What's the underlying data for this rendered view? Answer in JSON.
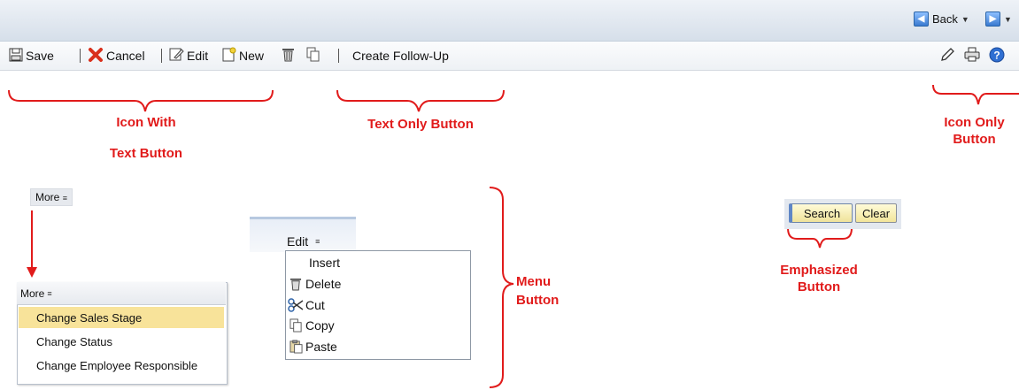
{
  "header": {
    "back_label": "Back",
    "forward_label": ""
  },
  "toolbar": {
    "save_label": "Save",
    "cancel_label": "Cancel",
    "edit_label": "Edit",
    "new_label": "New",
    "create_followup_label": "Create Follow-Up",
    "icons": [
      "save-icon",
      "cancel-icon",
      "edit-icon",
      "new-icon",
      "delete-icon",
      "copy-icon",
      "pencil-icon",
      "print-icon",
      "help-icon"
    ]
  },
  "annotations": {
    "icon_with_text_line1": "Icon With",
    "icon_with_text_line2": "Text Button",
    "text_only": "Text Only Button",
    "icon_only_line1": "Icon Only",
    "icon_only_line2": "Button",
    "menu_line1": "Menu",
    "menu_line2": "Button",
    "emphasized_line1": "Emphasized",
    "emphasized_line2": "Button"
  },
  "more_menu": {
    "label": "More",
    "items": [
      {
        "label": "Change Sales Stage",
        "selected": true
      },
      {
        "label": "Change Status",
        "selected": false
      },
      {
        "label": "Change Employee Responsible",
        "selected": false
      }
    ]
  },
  "edit_menu": {
    "label": "Edit",
    "items": [
      {
        "label": "Insert",
        "icon": ""
      },
      {
        "label": "Delete",
        "icon": "delete-icon"
      },
      {
        "label": "Cut",
        "icon": "cut-icon"
      },
      {
        "label": "Copy",
        "icon": "copy-icon"
      },
      {
        "label": "Paste",
        "icon": "paste-icon"
      }
    ]
  },
  "search": {
    "search_label": "Search",
    "clear_label": "Clear"
  },
  "colors": {
    "annotation": "#e11b1b",
    "selected_item": "#f8e39a",
    "button_fill": "#f2e59a"
  }
}
